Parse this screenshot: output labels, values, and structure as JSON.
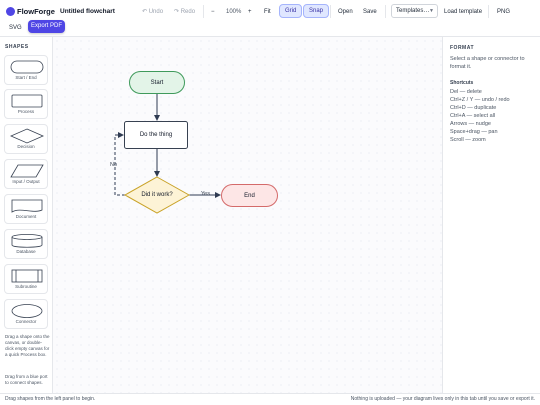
{
  "app": {
    "name": "FlowForge",
    "document_title": "Untitled flowchart",
    "accent_color": "#4f46e5"
  },
  "toolbar": {
    "undo": "↶ Undo",
    "redo": "↷ Redo",
    "zoom_out": "−",
    "zoom_level": "100%",
    "zoom_in": "+",
    "fit": "Fit",
    "grid": "Grid",
    "snap": "Snap",
    "open": "Open",
    "save": "Save",
    "templates": "Templates…",
    "load_template": "Load template",
    "png": "PNG",
    "svg": "SVG",
    "export_pdf": "Export PDF"
  },
  "shapes_panel": {
    "heading": "SHAPES",
    "items": [
      {
        "label": "Start / End"
      },
      {
        "label": "Process"
      },
      {
        "label": "Decision"
      },
      {
        "label": "Input / Output"
      },
      {
        "label": "Document"
      },
      {
        "label": "Database"
      },
      {
        "label": "Subroutine"
      },
      {
        "label": "Connector"
      }
    ],
    "hint_1": "Drag a shape onto the canvas, or double-click empty canvas for a quick Process box.",
    "hint_2": "Drag from a blue port to connect shapes."
  },
  "canvas": {
    "nodes": {
      "start": {
        "label": "Start",
        "fill": "#e3f4e8",
        "stroke": "#3f9a5b"
      },
      "process": {
        "label": "Do the thing",
        "fill": "#ffffff",
        "stroke": "#374151"
      },
      "decision": {
        "label": "Did it work?",
        "fill": "#fdf3d6",
        "stroke": "#c9a227"
      },
      "end": {
        "label": "End",
        "fill": "#fde6e6",
        "stroke": "#d46a6a"
      }
    },
    "edges": {
      "yes_label": "Yes",
      "no_label": "No",
      "color": "#2f3b52"
    }
  },
  "format_panel": {
    "heading": "FORMAT",
    "help": "Select a shape or connector to format it.",
    "shortcuts_heading": "Shortcuts",
    "shortcuts": [
      "Del — delete",
      "Ctrl+Z / Y — undo / redo",
      "Ctrl+D — duplicate",
      "Ctrl+A — select all",
      "Arrows — nudge",
      "Space+drag — pan",
      "Scroll — zoom"
    ]
  },
  "status_bar": {
    "left": "Drag shapes from the left panel to begin.",
    "right": "Nothing is uploaded — your diagram lives only in this tab until you save or export it."
  }
}
